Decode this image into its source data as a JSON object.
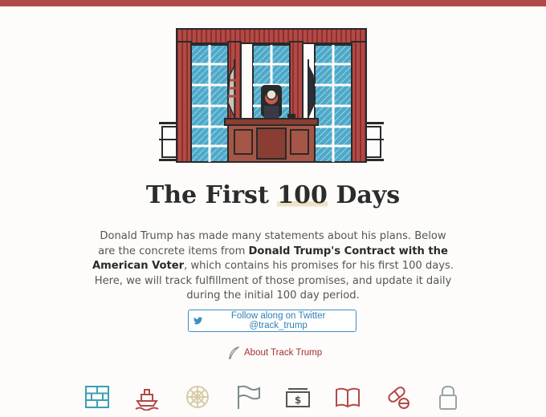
{
  "page": {
    "accent": "#b04a48"
  },
  "hero": {
    "illustration": "oval-office-illustration"
  },
  "title": {
    "pre": "The First ",
    "number": "100",
    "post": " Days"
  },
  "intro": {
    "part1": "Donald Trump has made many statements about his plans. Below are the concrete items from ",
    "bold": "Donald Trump's Contract with the American Voter",
    "part2": ", which contains his promises for his first 100 days. Here, we will track fulfillment of those promises, and update it daily during the initial 100 day period."
  },
  "follow": {
    "label": "Follow along on Twitter @track_trump",
    "icon": "twitter-bird-icon",
    "color": "#3d8fc1"
  },
  "about": {
    "label": "About Track Trump",
    "icon": "quill-icon",
    "color": "#a33232"
  },
  "topics": [
    {
      "icon": "brick-wall-icon",
      "color": "#3aa0b5"
    },
    {
      "icon": "ship-icon",
      "color": "#b04a48"
    },
    {
      "icon": "seal-icon",
      "color": "#d8cba7"
    },
    {
      "icon": "flag-icon",
      "color": "#7a8c8c"
    },
    {
      "icon": "money-icon",
      "color": "#555555"
    },
    {
      "icon": "book-icon",
      "color": "#b04a48"
    },
    {
      "icon": "pill-icon",
      "color": "#b04a48"
    },
    {
      "icon": "lock-icon",
      "color": "#9aa3a3"
    }
  ]
}
